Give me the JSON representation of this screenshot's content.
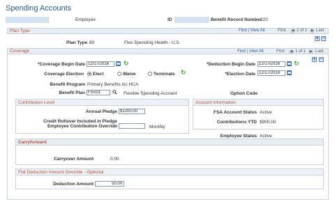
{
  "page_title": "Spending Accounts",
  "header": {
    "employee_label": "Employee",
    "id_label": "ID",
    "benefit_record_label": "Benefit Record Number",
    "benefit_record_value": "220"
  },
  "plan_type_section": {
    "title": "Plan Type",
    "nav": {
      "find": "Find",
      "view_all": "View All",
      "first": "First",
      "range": "1 of 1",
      "last": "Last"
    },
    "plan_type_label": "Plan Type",
    "plan_type_code": "60",
    "plan_type_desc": "Flex Spending Health - U.S."
  },
  "coverage_section": {
    "title": "Coverage",
    "nav": {
      "find": "Find",
      "view_all": "View All",
      "first": "First",
      "range": "1 of 1",
      "last": "Last"
    },
    "coverage_begin_label": "*Coverage Begin Date",
    "coverage_begin_value": "12/17/2016",
    "deduction_begin_label": "*Deduction Begin Date",
    "deduction_begin_value": "12/17/2016",
    "coverage_election_label": "Coverage Election",
    "election_options": [
      "Elect",
      "Waive",
      "Terminate"
    ],
    "election_selected": "Elect",
    "election_date_label": "*Election Date",
    "election_date_value": "12/17/2016",
    "benefit_program_label": "Benefit Program",
    "benefit_program_value": "Primary Benefits inc HCA",
    "benefit_plan_label": "Benefit Plan",
    "benefit_plan_value": "FSA01",
    "benefit_plan_desc": "Flexible Spending Account",
    "option_code_label": "Option Code"
  },
  "contribution_level": {
    "title": "Contribution Level",
    "annual_pledge_label": "Annual Pledge",
    "annual_pledge_value": "$1200.00",
    "rollover_label_1": "Credit Rollover Included in Pledge",
    "override_label": "Employee Contribution Override",
    "override_value": "",
    "override_unit": "Monthly"
  },
  "account_information": {
    "title": "Account Information",
    "fsa_status_label": "FSA Account Status",
    "fsa_status_value": "Active",
    "contributions_ytd_label": "Contributions YTD",
    "contributions_ytd_value": "$900.00",
    "employee_status_label": "Employee Status",
    "employee_status_value": "Active"
  },
  "carryforward": {
    "title": "Carryforward",
    "carryover_label": "Carryover Amount",
    "carryover_value": "0.00"
  },
  "flat_deduction": {
    "title": "Flat Deduction Amount Override - Optional",
    "deduction_amount_label": "Deduction Amount",
    "deduction_amount_value": "50.00"
  }
}
